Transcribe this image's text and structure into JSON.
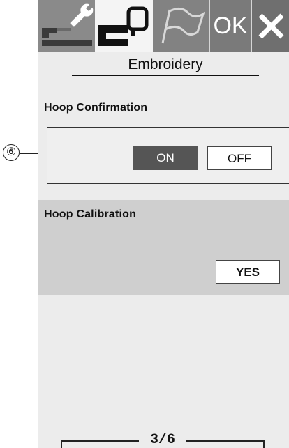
{
  "toolbar": {
    "tabs": [
      {
        "name": "settings",
        "icon": "wrench-icon",
        "active": false
      },
      {
        "name": "embroidery",
        "icon": "embroidery-machine-icon",
        "active": true
      },
      {
        "name": "language",
        "icon": "flag-icon",
        "active": false
      }
    ],
    "ok_label": "OK",
    "close_icon": "close-icon"
  },
  "page_title": "Embroidery",
  "hoop_confirmation": {
    "label": "Hoop Confirmation",
    "on_label": "ON",
    "off_label": "OFF",
    "selected": "ON"
  },
  "hoop_calibration": {
    "label": "Hoop Calibration",
    "yes_label": "YES"
  },
  "pager": {
    "text": "3/6"
  },
  "callout": {
    "number": "⑥"
  },
  "colors": {
    "screen_bg": "#ececec",
    "tabbar_bg": "#777777",
    "active_button": "#555555",
    "calibration_bg": "#cfcfcf"
  }
}
